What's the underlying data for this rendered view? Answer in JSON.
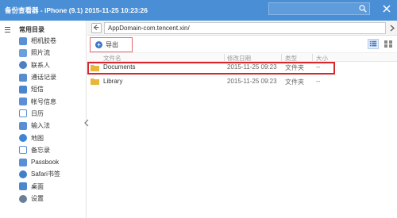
{
  "window": {
    "title": "备份查看器 - iPhone (9.1) 2015-11-25 10:23:26"
  },
  "sidebar": {
    "section_label": "常用目录",
    "items": [
      {
        "label": "相机胶卷",
        "icon": "camera-roll-icon",
        "color": "#5a8fd6"
      },
      {
        "label": "照片流",
        "icon": "photo-stream-icon",
        "color": "#6aa0dc"
      },
      {
        "label": "联系人",
        "icon": "contacts-icon",
        "color": "#4c7fc4"
      },
      {
        "label": "通话记录",
        "icon": "call-log-icon",
        "color": "#5b8ccc"
      },
      {
        "label": "短信",
        "icon": "sms-icon",
        "color": "#4a86d0"
      },
      {
        "label": "帐号信息",
        "icon": "account-icon",
        "color": "#5a8fd6"
      },
      {
        "label": "日历",
        "icon": "calendar-icon",
        "color": "#5a8fd6"
      },
      {
        "label": "输入法",
        "icon": "keyboard-icon",
        "color": "#5a8fd6"
      },
      {
        "label": "地图",
        "icon": "map-icon",
        "color": "#3d86d6"
      },
      {
        "label": "备忘录",
        "icon": "notes-icon",
        "color": "#5a8fd6"
      },
      {
        "label": "Passbook",
        "icon": "passbook-icon",
        "color": "#5a8fd6"
      },
      {
        "label": "Safari书签",
        "icon": "safari-icon",
        "color": "#3f7fcc"
      },
      {
        "label": "桌面",
        "icon": "desktop-icon",
        "color": "#4d88cf"
      },
      {
        "label": "设置",
        "icon": "settings-icon",
        "color": "#6b7f99"
      }
    ]
  },
  "path": {
    "value": "AppDomain-com.tencent.xin/"
  },
  "toolbar": {
    "export_label": "导出"
  },
  "table": {
    "columns": [
      "文件名",
      "修改日期",
      "类型",
      "大小"
    ],
    "rows": [
      {
        "name": "Documents",
        "modified": "2015-11-25 09:23",
        "type": "文件夹",
        "size": "--"
      },
      {
        "name": "Library",
        "modified": "2015-11-25 09:23",
        "type": "文件夹",
        "size": "--"
      }
    ]
  },
  "colors": {
    "titlebar": "#4a8fd6",
    "highlight": "#d9262c",
    "accent": "#3a78c8"
  }
}
